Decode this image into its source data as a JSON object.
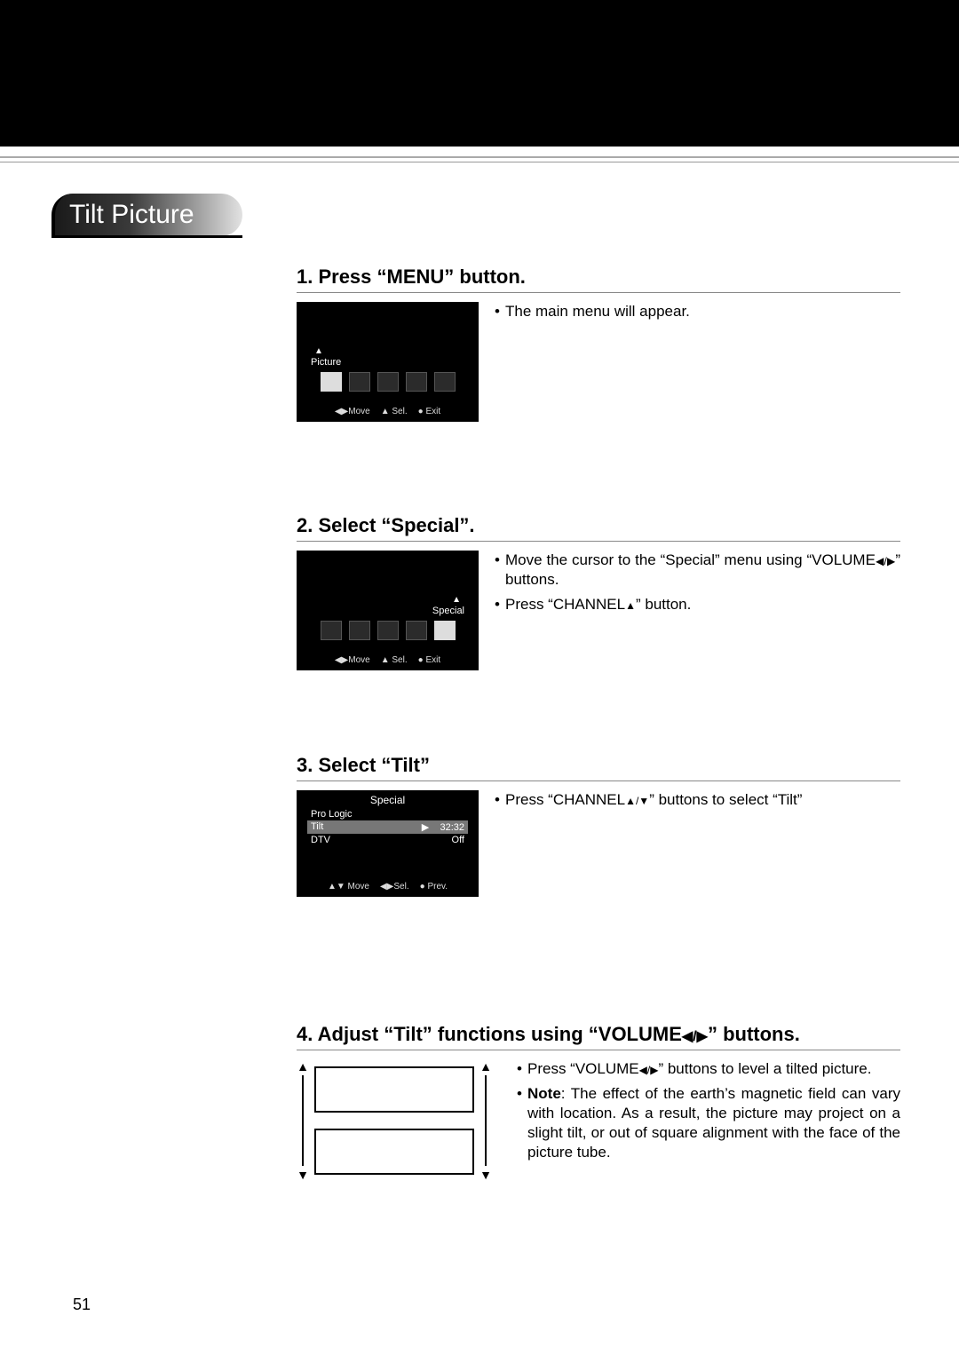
{
  "title": "Tilt Picture",
  "page_number": "51",
  "steps": [
    {
      "heading": "1. Press “MENU” button.",
      "screen": {
        "type": "mainmenu",
        "label": "Picture",
        "label_side": "left",
        "selected_index": 0,
        "nav": {
          "move": "Move",
          "sel": "Sel.",
          "exit": "Exit"
        }
      },
      "bullets": [
        {
          "text": "The main menu will appear."
        }
      ]
    },
    {
      "heading": "2. Select “Special”.",
      "screen": {
        "type": "mainmenu",
        "label": "Special",
        "label_side": "right",
        "selected_index": 4,
        "nav": {
          "move": "Move",
          "sel": "Sel.",
          "exit": "Exit"
        }
      },
      "bullets": [
        {
          "text_pre": "Move the cursor to the “Special” menu using “VOLUME",
          "text_post": "” buttons.",
          "tri": "◀/▶"
        },
        {
          "text_pre": "Press “CHANNEL",
          "text_post": "” button.",
          "tri": "▲"
        }
      ]
    },
    {
      "heading": "3. Select “Tilt”",
      "screen": {
        "type": "submenu",
        "title": "Special",
        "rows": [
          {
            "label": "Pro Logic",
            "value": ""
          },
          {
            "label": "Tilt",
            "value": "32:32",
            "arrow": "▶",
            "highlight": true
          },
          {
            "label": "DTV",
            "value": "Off"
          }
        ],
        "nav": {
          "move": "Move",
          "sel": "Sel.",
          "exit": "Prev."
        }
      },
      "bullets": [
        {
          "text_pre": "Press “CHANNEL",
          "text_post": "” buttons to select “Tilt”",
          "tri": "▲/▼"
        }
      ]
    },
    {
      "heading_pre": "4. Adjust “Tilt” functions using “VOLUME",
      "heading_post": "” buttons.",
      "heading_tri": "◀/▶",
      "screen": {
        "type": "tilt"
      },
      "bullets": [
        {
          "text_pre": "Press “VOLUME",
          "text_post": "” buttons to level a tilted picture.",
          "tri": "◀/▶"
        },
        {
          "note_label": "Note",
          "text": ": The effect of the earth’s magnetic field can vary with location. As a result, the picture may project on a slight tilt, or out of square alignment with the face of the picture tube."
        }
      ]
    }
  ],
  "nav_symbols": {
    "move": "◀▶",
    "sel_up": "▲",
    "exit_dot": "●",
    "updown": "▲▼"
  }
}
